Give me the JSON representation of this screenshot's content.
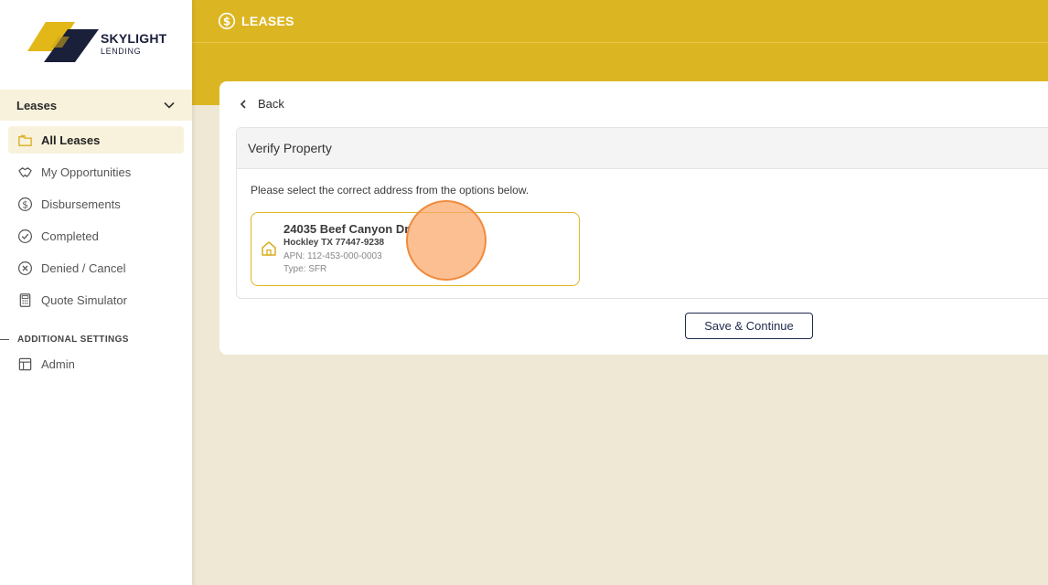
{
  "brand": {
    "name": "SKYLIGHT",
    "sub": "LENDING",
    "colors": {
      "gold": "#dcb622",
      "navy": "#1a1f3a"
    }
  },
  "header": {
    "title": "LEASES",
    "icon": "dollar-circle-icon"
  },
  "sidebar": {
    "section": {
      "label": "Leases",
      "icon": "chevron-down-icon"
    },
    "items": [
      {
        "label": "All Leases",
        "icon": "folder-icon",
        "active": true
      },
      {
        "label": "My Opportunities",
        "icon": "handshake-icon"
      },
      {
        "label": "Disbursements",
        "icon": "dollar-circle-icon"
      },
      {
        "label": "Completed",
        "icon": "check-circle-icon"
      },
      {
        "label": "Denied / Cancel",
        "icon": "x-circle-icon"
      },
      {
        "label": "Quote Simulator",
        "icon": "calculator-icon"
      }
    ],
    "additional_label": "ADDITIONAL SETTINGS",
    "additional_items": [
      {
        "label": "Admin",
        "icon": "layout-icon"
      }
    ]
  },
  "main": {
    "back_label": "Back",
    "panel_title": "Verify Property",
    "instruction": "Please select the correct address from the options below.",
    "option": {
      "street": "24035 Beef Canyon Dr",
      "city": "Hockley TX 77447-9238",
      "apn": "APN: 112-453-000-0003",
      "type": "Type: SFR"
    },
    "save_label": "Save & Continue"
  }
}
